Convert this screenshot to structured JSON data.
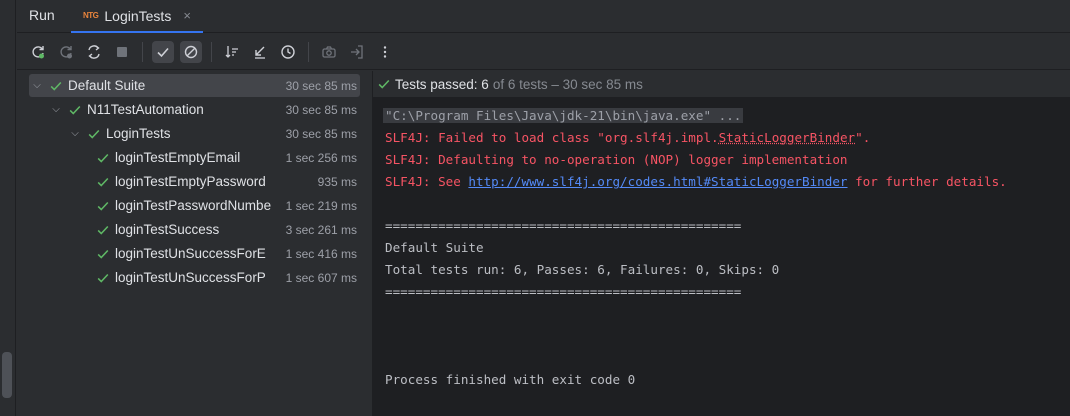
{
  "header": {
    "run_label": "Run",
    "tab_icon_text": "NTG",
    "tab_title": "LoginTests",
    "close_glyph": "×"
  },
  "toolbar": {
    "buttons": [
      "rerun-icon",
      "rerun-failed-icon",
      "toggle-auto-test-icon",
      "stop-icon",
      "show-passed-icon",
      "show-ignored-icon",
      "sort-icon",
      "collapse-icon",
      "history-icon",
      "screenshot-icon",
      "export-icon",
      "more-icon"
    ]
  },
  "tree": {
    "rows": [
      {
        "name": "Default Suite",
        "time": "30 sec 85 ms"
      },
      {
        "name": "N11TestAutomation",
        "time": "30 sec 85 ms"
      },
      {
        "name": "LoginTests",
        "time": "30 sec 85 ms"
      },
      {
        "name": "loginTestEmptyEmail",
        "time": "1 sec 256 ms"
      },
      {
        "name": "loginTestEmptyPassword",
        "time": "935 ms"
      },
      {
        "name": "loginTestPasswordNumbe",
        "time": "1 sec 219 ms"
      },
      {
        "name": "loginTestSuccess",
        "time": "3 sec 261 ms"
      },
      {
        "name": "loginTestUnSuccessForE",
        "time": "1 sec 416 ms"
      },
      {
        "name": "loginTestUnSuccessForP",
        "time": "1 sec 607 ms"
      }
    ]
  },
  "status": {
    "passed": "Tests passed: 6",
    "rest": "of 6 tests – 30 sec 85 ms"
  },
  "console": {
    "cmd": "\"C:\\Program Files\\Java\\jdk-21\\bin\\java.exe\" ...",
    "err1_a": "SLF4J: Failed to load class \"org.slf4j.impl.",
    "err1_b": "StaticLoggerBinder",
    "err1_c": "\".",
    "err2": "SLF4J: Defaulting to no-operation (NOP) logger implementation",
    "err3_a": "SLF4J: See ",
    "err3_link": "http://www.slf4j.org/codes.html#StaticLoggerBinder",
    "err3_c": " for further details.",
    "sep1": "===============================================",
    "suite": "Default Suite",
    "totals": "Total tests run: 6, Passes: 6, Failures: 0, Skips: 0",
    "sep2": "===============================================",
    "exit": "Process finished with exit code 0"
  },
  "colors": {
    "pass_green": "#5fb865",
    "error_red": "#f75464",
    "link_blue": "#548af7",
    "accent": "#3574f0"
  }
}
